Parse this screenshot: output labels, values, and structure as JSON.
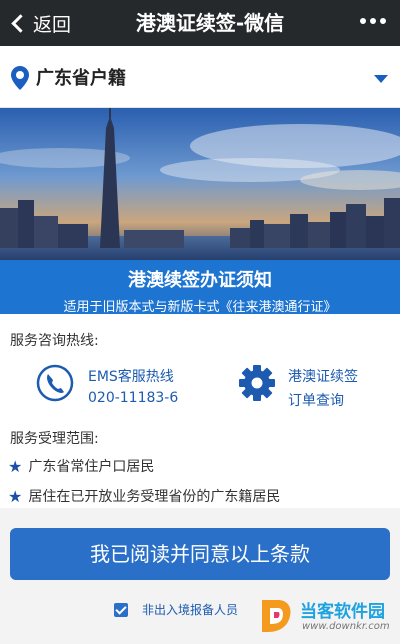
{
  "nav": {
    "back_label": "返回",
    "title": "港澳证续签-微信"
  },
  "region": {
    "label": "广东省户籍"
  },
  "notice": {
    "title": "港澳续签办证须知",
    "subtitle": "适用于旧版本式与新版卡式《往来港澳通行证》"
  },
  "hotline": {
    "section_label": "服务咨询热线:",
    "ems_label": "EMS客服热线",
    "ems_number": "020-11183-6",
    "order_line1": "港澳证续签",
    "order_line2": "订单查询"
  },
  "scope": {
    "section_label": "服务受理范围:",
    "items": [
      "广东省常住户口居民",
      "居住在已开放业务受理省份的广东籍居民"
    ]
  },
  "agree_button": "我已阅读并同意以上条款",
  "checkbox_label": "非出入境报备人员",
  "watermark": {
    "name": "当客软件园",
    "url": "www.downkr.com"
  },
  "colors": {
    "nav_bg": "#25292c",
    "accent_blue": "#1e74d1",
    "button_blue": "#2a70c9",
    "link_blue": "#1c5bb0"
  }
}
